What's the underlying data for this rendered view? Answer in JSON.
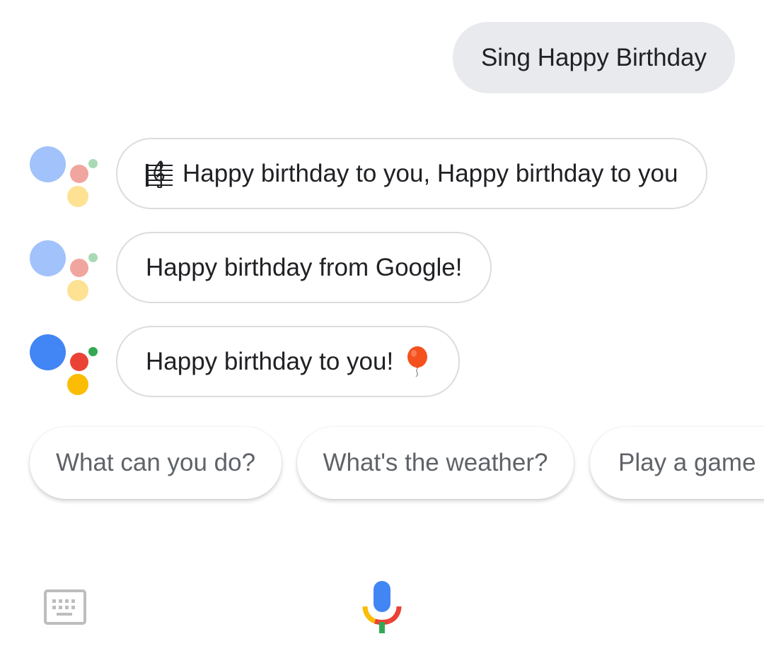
{
  "conversation": {
    "user_query": "Sing Happy Birthday",
    "responses": [
      {
        "text": "Happy birthday to you, Happy birthday to you",
        "icon": "music-score-icon"
      },
      {
        "text": "Happy birthday from Google!"
      },
      {
        "text": "Happy birthday to you!",
        "icon": "balloon-icon"
      }
    ]
  },
  "suggestions": [
    "What can you do?",
    "What's the weather?",
    "Play a game"
  ],
  "bottom_bar": {
    "keyboard_icon": "keyboard-icon",
    "mic_icon": "mic-icon"
  },
  "colors": {
    "google_blue": "#4285f4",
    "google_red": "#ea4335",
    "google_yellow": "#fbbc04",
    "google_green": "#34a853",
    "user_bubble_bg": "#e9eaee",
    "bubble_border": "#dadce0",
    "suggestion_text": "#5f6368"
  }
}
